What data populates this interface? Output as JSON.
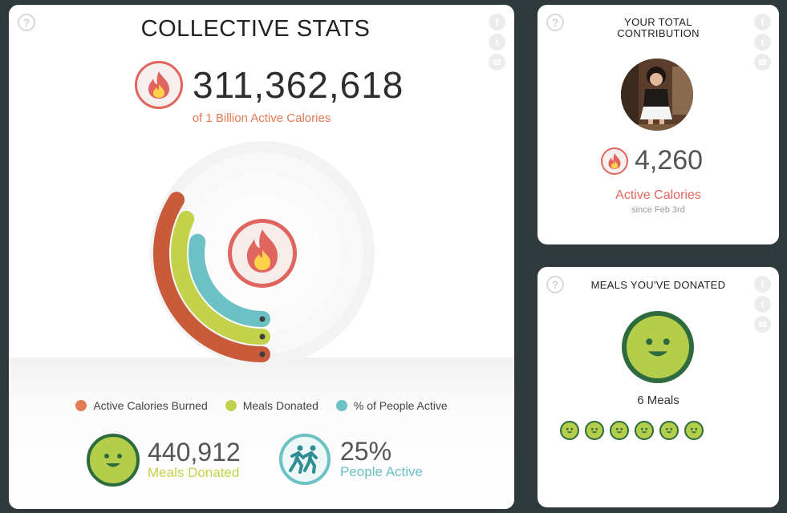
{
  "collective": {
    "title": "COLLECTIVE STATS",
    "total_calories": "311,362,618",
    "goal_text": "of 1 Billion Active Calories",
    "help": "?",
    "social": [
      "f",
      "t",
      "✉"
    ],
    "legend": [
      {
        "label": "Active Calories Burned",
        "color": "#e07b55"
      },
      {
        "label": "Meals Donated",
        "color": "#c3d24b"
      },
      {
        "label": "% of People Active",
        "color": "#6cc1c4"
      }
    ],
    "rings": {
      "calories_fraction": 0.311,
      "meals_fraction": 0.29,
      "people_fraction": 0.25,
      "colors": {
        "calories": "#c95b3a",
        "meals": "#c3d24b",
        "people": "#6cc1c4",
        "track": "#f0f0f0"
      }
    },
    "meals_stat": {
      "value": "440,912",
      "label": "Meals Donated",
      "color": "#c3d24b"
    },
    "people_stat": {
      "value": "25%",
      "label": "People Active",
      "color": "#6cc1c4"
    }
  },
  "contribution": {
    "title_line1": "YOUR TOTAL",
    "title_line2": "CONTRIBUTION",
    "value": "4,260",
    "label": "Active Calories",
    "since": "since Feb 3rd",
    "help": "?",
    "social": [
      "f",
      "t",
      "✉"
    ]
  },
  "meals": {
    "title": "MEALS YOU'VE DONATED",
    "count_text": "6 Meals",
    "meal_count": 6,
    "help": "?",
    "social": [
      "f",
      "t",
      "✉"
    ]
  },
  "colors": {
    "accent_red": "#e0655f",
    "green_dark": "#2d6a3e",
    "lime": "#b4ce4b",
    "teal": "#6cc1c4"
  }
}
